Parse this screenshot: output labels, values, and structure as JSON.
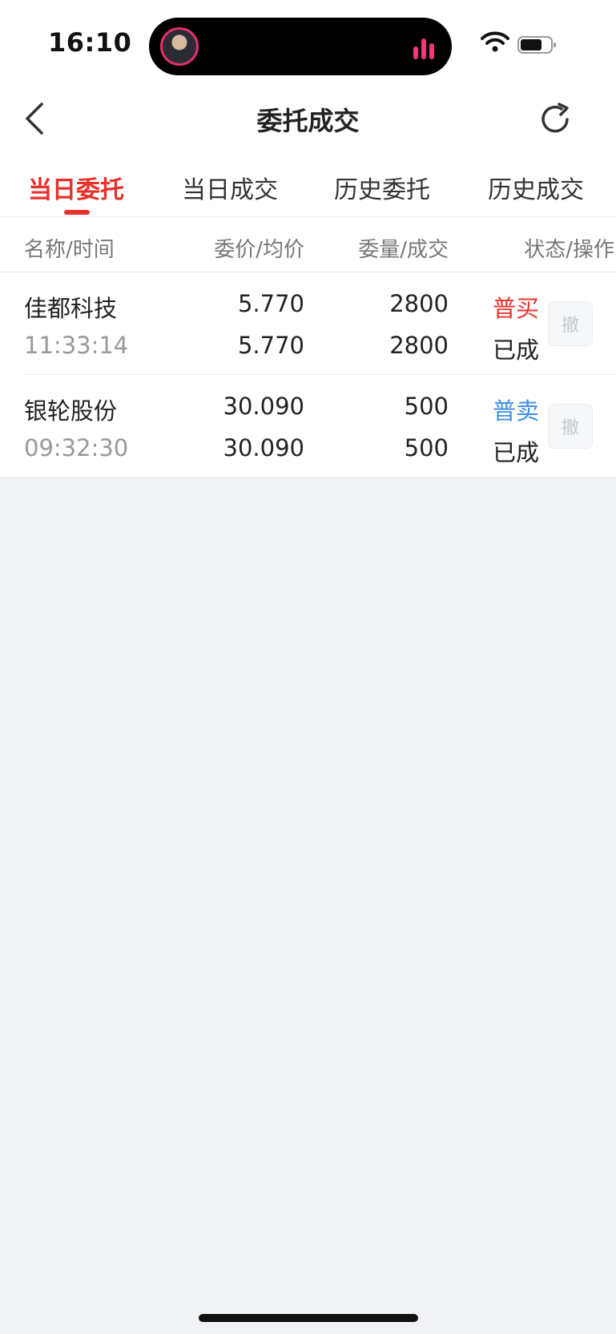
{
  "status_bar": {
    "time": "16:10"
  },
  "nav": {
    "title": "委托成交"
  },
  "tabs": [
    {
      "label": "当日委托",
      "active": true
    },
    {
      "label": "当日成交",
      "active": false
    },
    {
      "label": "历史委托",
      "active": false
    },
    {
      "label": "历史成交",
      "active": false
    }
  ],
  "table": {
    "headers": [
      "名称/时间",
      "委价/均价",
      "委量/成交",
      "状态/操作"
    ],
    "rows": [
      {
        "name": "佳都科技",
        "time": "11:33:14",
        "order_price": "5.770",
        "avg_price": "5.770",
        "order_qty": "2800",
        "filled_qty": "2800",
        "type": "普买",
        "status": "已成",
        "cancel_label": "撤"
      },
      {
        "name": "银轮股份",
        "time": "09:32:30",
        "order_price": "30.090",
        "avg_price": "30.090",
        "order_qty": "500",
        "filled_qty": "500",
        "type": "普卖",
        "status": "已成",
        "cancel_label": "撤"
      }
    ]
  },
  "colors": {
    "accent": "#e8312b",
    "buy": "#e8312b",
    "sell": "#3a8ee6",
    "background": "#f1f2f6"
  },
  "icons": {
    "back": "chevron-left-icon",
    "refresh": "refresh-icon",
    "wifi": "wifi-icon",
    "battery": "battery-icon"
  }
}
